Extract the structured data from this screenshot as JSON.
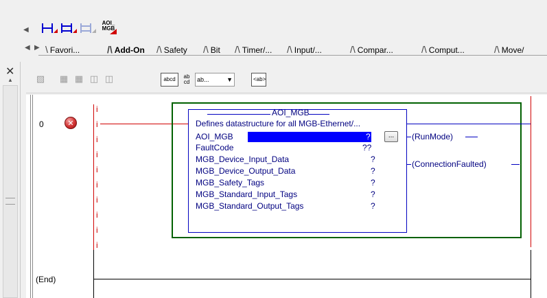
{
  "toolbar": {
    "aoi_button_label": "AOI_\nMGB"
  },
  "tabs": [
    {
      "label": "Favori...",
      "active": false
    },
    {
      "label": "Add-On",
      "active": true
    },
    {
      "label": "Safety",
      "active": false
    },
    {
      "label": "Bit",
      "active": false
    },
    {
      "label": "Timer/...",
      "active": false
    },
    {
      "label": "Input/...",
      "active": false
    },
    {
      "label": "Compar...",
      "active": false
    },
    {
      "label": "Comput...",
      "active": false
    },
    {
      "label": "Move/",
      "active": false
    }
  ],
  "editor_toolbar": {
    "abcd_label": "abcd",
    "ab_cd_label": "ab\ncd",
    "combo_value": "ab...",
    "ab_tag_label": "<ab>"
  },
  "ladder": {
    "rung0_number": "0",
    "end_label": "(End)",
    "rail_marker": "i"
  },
  "aoi": {
    "title": "AOI_MGB",
    "description": "Defines datastructure for all MGB-Ethernet/...",
    "rows": [
      {
        "name": "AOI_MGB",
        "value": "?"
      },
      {
        "name": "FaultCode",
        "value": "??"
      },
      {
        "name": "MGB_Device_Input_Data",
        "value": "?"
      },
      {
        "name": "MGB_Device_Output_Data",
        "value": "?"
      },
      {
        "name": "MGB_Safety_Tags",
        "value": "?"
      },
      {
        "name": "MGB_Standard_Input_Tags",
        "value": "?"
      },
      {
        "name": "MGB_Standard_Output_Tags",
        "value": "?"
      }
    ],
    "ellipsis": "...",
    "outputs": [
      "RunMode",
      "ConnectionFaulted"
    ]
  },
  "colors": {
    "rung_error_rail": "#d00000",
    "aoi_border": "#0000c0",
    "rung_border": "#006000",
    "highlight": "#0000ff"
  }
}
